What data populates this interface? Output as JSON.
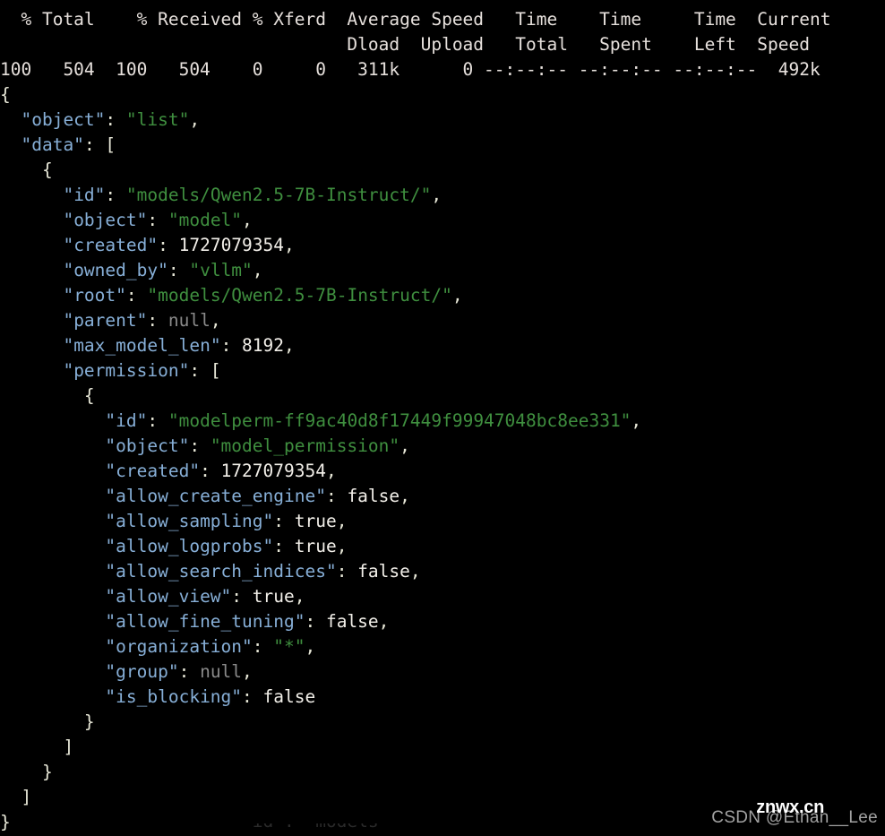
{
  "terminal": {
    "background": "#000000",
    "foreground": "#d8d8d8",
    "colors": {
      "key": "#87afd7",
      "string": "#3f8f3f",
      "number": "#f2efe9",
      "boolean": "#f2efe9",
      "null": "#8a8a8a",
      "punctuation": "#e8e8d8"
    }
  },
  "curl_progress": {
    "clipped_top_line": "  % Total    % Received % Xferd  Average Speed   Time    Time     Time  Current",
    "header_line_1": "  % Total    % Received % Xferd  Average Speed   Time    Time     Time  Current",
    "header_line_2": "                                 Dload  Upload   Total   Spent    Left  Speed",
    "data_line": "100   504  100   504    0     0   311k      0 --:--:-- --:--:-- --:--:--  492k",
    "fields": {
      "percent_total": "100",
      "total": "504",
      "percent_received": "100",
      "received": "504",
      "percent_xferd": "0",
      "xferd": "0",
      "average_speed_dload": "311k",
      "average_speed_upload": "0",
      "time_total": "--:--:--",
      "time_spent": "--:--:--",
      "time_left": "--:--:--",
      "current_speed": "492k"
    },
    "column_labels": [
      "% Total",
      "% Received",
      "% Xferd",
      "Average Speed",
      "Time",
      "Time",
      "Time",
      "Current",
      "Dload",
      "Upload",
      "Total",
      "Spent",
      "Left",
      "Speed"
    ]
  },
  "json_output": {
    "lines": [
      {
        "indent": 0,
        "tokens": [
          {
            "t": "punct",
            "v": "{"
          }
        ]
      },
      {
        "indent": 2,
        "tokens": [
          {
            "t": "key",
            "v": "\"object\""
          },
          {
            "t": "punct",
            "v": ": "
          },
          {
            "t": "str",
            "v": "\"list\""
          },
          {
            "t": "punct",
            "v": ","
          }
        ]
      },
      {
        "indent": 2,
        "tokens": [
          {
            "t": "key",
            "v": "\"data\""
          },
          {
            "t": "punct",
            "v": ": ["
          }
        ]
      },
      {
        "indent": 4,
        "tokens": [
          {
            "t": "punct",
            "v": "{"
          }
        ]
      },
      {
        "indent": 6,
        "tokens": [
          {
            "t": "key",
            "v": "\"id\""
          },
          {
            "t": "punct",
            "v": ": "
          },
          {
            "t": "str",
            "v": "\"models/Qwen2.5-7B-Instruct/\""
          },
          {
            "t": "punct",
            "v": ","
          }
        ]
      },
      {
        "indent": 6,
        "tokens": [
          {
            "t": "key",
            "v": "\"object\""
          },
          {
            "t": "punct",
            "v": ": "
          },
          {
            "t": "str",
            "v": "\"model\""
          },
          {
            "t": "punct",
            "v": ","
          }
        ]
      },
      {
        "indent": 6,
        "tokens": [
          {
            "t": "key",
            "v": "\"created\""
          },
          {
            "t": "punct",
            "v": ": "
          },
          {
            "t": "num",
            "v": "1727079354"
          },
          {
            "t": "punct",
            "v": ","
          }
        ]
      },
      {
        "indent": 6,
        "tokens": [
          {
            "t": "key",
            "v": "\"owned_by\""
          },
          {
            "t": "punct",
            "v": ": "
          },
          {
            "t": "str",
            "v": "\"vllm\""
          },
          {
            "t": "punct",
            "v": ","
          }
        ]
      },
      {
        "indent": 6,
        "tokens": [
          {
            "t": "key",
            "v": "\"root\""
          },
          {
            "t": "punct",
            "v": ": "
          },
          {
            "t": "str",
            "v": "\"models/Qwen2.5-7B-Instruct/\""
          },
          {
            "t": "punct",
            "v": ","
          }
        ]
      },
      {
        "indent": 6,
        "tokens": [
          {
            "t": "key",
            "v": "\"parent\""
          },
          {
            "t": "punct",
            "v": ": "
          },
          {
            "t": "nul",
            "v": "null"
          },
          {
            "t": "punct",
            "v": ","
          }
        ]
      },
      {
        "indent": 6,
        "tokens": [
          {
            "t": "key",
            "v": "\"max_model_len\""
          },
          {
            "t": "punct",
            "v": ": "
          },
          {
            "t": "num",
            "v": "8192"
          },
          {
            "t": "punct",
            "v": ","
          }
        ]
      },
      {
        "indent": 6,
        "tokens": [
          {
            "t": "key",
            "v": "\"permission\""
          },
          {
            "t": "punct",
            "v": ": ["
          }
        ]
      },
      {
        "indent": 8,
        "tokens": [
          {
            "t": "punct",
            "v": "{"
          }
        ]
      },
      {
        "indent": 10,
        "tokens": [
          {
            "t": "key",
            "v": "\"id\""
          },
          {
            "t": "punct",
            "v": ": "
          },
          {
            "t": "str",
            "v": "\"modelperm-ff9ac40d8f17449f99947048bc8ee331\""
          },
          {
            "t": "punct",
            "v": ","
          }
        ]
      },
      {
        "indent": 10,
        "tokens": [
          {
            "t": "key",
            "v": "\"object\""
          },
          {
            "t": "punct",
            "v": ": "
          },
          {
            "t": "str",
            "v": "\"model_permission\""
          },
          {
            "t": "punct",
            "v": ","
          }
        ]
      },
      {
        "indent": 10,
        "tokens": [
          {
            "t": "key",
            "v": "\"created\""
          },
          {
            "t": "punct",
            "v": ": "
          },
          {
            "t": "num",
            "v": "1727079354"
          },
          {
            "t": "punct",
            "v": ","
          }
        ]
      },
      {
        "indent": 10,
        "tokens": [
          {
            "t": "key",
            "v": "\"allow_create_engine\""
          },
          {
            "t": "punct",
            "v": ": "
          },
          {
            "t": "bool",
            "v": "false"
          },
          {
            "t": "punct",
            "v": ","
          }
        ]
      },
      {
        "indent": 10,
        "tokens": [
          {
            "t": "key",
            "v": "\"allow_sampling\""
          },
          {
            "t": "punct",
            "v": ": "
          },
          {
            "t": "bool",
            "v": "true"
          },
          {
            "t": "punct",
            "v": ","
          }
        ]
      },
      {
        "indent": 10,
        "tokens": [
          {
            "t": "key",
            "v": "\"allow_logprobs\""
          },
          {
            "t": "punct",
            "v": ": "
          },
          {
            "t": "bool",
            "v": "true"
          },
          {
            "t": "punct",
            "v": ","
          }
        ]
      },
      {
        "indent": 10,
        "tokens": [
          {
            "t": "key",
            "v": "\"allow_search_indices\""
          },
          {
            "t": "punct",
            "v": ": "
          },
          {
            "t": "bool",
            "v": "false"
          },
          {
            "t": "punct",
            "v": ","
          }
        ]
      },
      {
        "indent": 10,
        "tokens": [
          {
            "t": "key",
            "v": "\"allow_view\""
          },
          {
            "t": "punct",
            "v": ": "
          },
          {
            "t": "bool",
            "v": "true"
          },
          {
            "t": "punct",
            "v": ","
          }
        ]
      },
      {
        "indent": 10,
        "tokens": [
          {
            "t": "key",
            "v": "\"allow_fine_tuning\""
          },
          {
            "t": "punct",
            "v": ": "
          },
          {
            "t": "bool",
            "v": "false"
          },
          {
            "t": "punct",
            "v": ","
          }
        ]
      },
      {
        "indent": 10,
        "tokens": [
          {
            "t": "key",
            "v": "\"organization\""
          },
          {
            "t": "punct",
            "v": ": "
          },
          {
            "t": "str",
            "v": "\"*\""
          },
          {
            "t": "punct",
            "v": ","
          }
        ]
      },
      {
        "indent": 10,
        "tokens": [
          {
            "t": "key",
            "v": "\"group\""
          },
          {
            "t": "punct",
            "v": ": "
          },
          {
            "t": "nul",
            "v": "null"
          },
          {
            "t": "punct",
            "v": ","
          }
        ]
      },
      {
        "indent": 10,
        "tokens": [
          {
            "t": "key",
            "v": "\"is_blocking\""
          },
          {
            "t": "punct",
            "v": ": "
          },
          {
            "t": "bool",
            "v": "false"
          }
        ]
      },
      {
        "indent": 8,
        "tokens": [
          {
            "t": "punct",
            "v": "}"
          }
        ]
      },
      {
        "indent": 6,
        "tokens": [
          {
            "t": "punct",
            "v": "]"
          }
        ]
      },
      {
        "indent": 4,
        "tokens": [
          {
            "t": "punct",
            "v": "}"
          }
        ]
      },
      {
        "indent": 2,
        "tokens": [
          {
            "t": "punct",
            "v": "]"
          }
        ]
      },
      {
        "indent": 0,
        "tokens": [
          {
            "t": "punct",
            "v": "}"
          }
        ]
      }
    ]
  },
  "watermarks": {
    "csdn": "CSDN @Ethan__Lee",
    "znwx": "znwx.cn"
  },
  "bottom_sliver_text": "                       \"id\": \"models"
}
